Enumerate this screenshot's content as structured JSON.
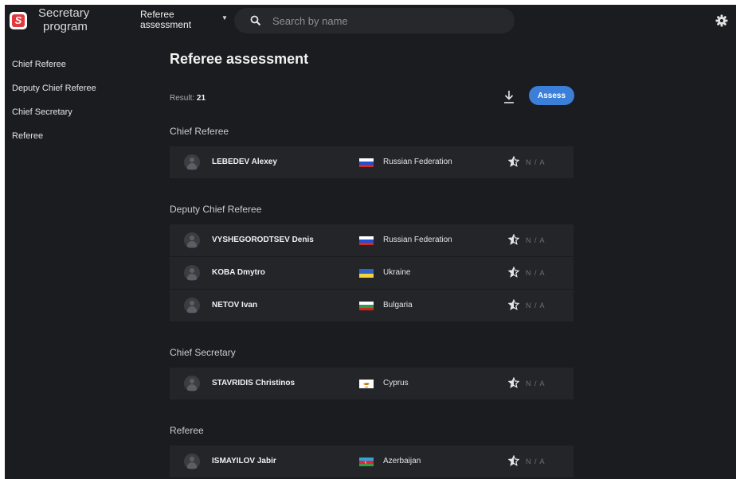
{
  "app": {
    "title_line1": "Secretary",
    "title_line2": "program",
    "logo_letter": "S",
    "accent": "#3b7fd9",
    "logo_color": "#e0393e"
  },
  "header": {
    "module_line1": "Referee",
    "module_line2": "assessment",
    "search_placeholder": "Search by name"
  },
  "sidebar": {
    "items": [
      {
        "label": "Chief Referee"
      },
      {
        "label": "Deputy Chief Referee"
      },
      {
        "label": "Chief Secretary"
      },
      {
        "label": "Referee"
      }
    ]
  },
  "main": {
    "title": "Referee assessment",
    "result_label": "Result:",
    "result_count": "21",
    "assess_label": "Assess",
    "groups": [
      {
        "title": "Chief Referee",
        "rows": [
          {
            "name": "LEBEDEV Alexey",
            "country": "Russian Federation",
            "flag": "russia",
            "rating": "N / A"
          }
        ]
      },
      {
        "title": "Deputy Chief Referee",
        "rows": [
          {
            "name": "VYSHEGORODTSEV Denis",
            "country": "Russian Federation",
            "flag": "russia",
            "rating": "N / A"
          },
          {
            "name": "KOBA Dmytro",
            "country": "Ukraine",
            "flag": "ukraine",
            "rating": "N / A"
          },
          {
            "name": "NETOV Ivan",
            "country": "Bulgaria",
            "flag": "bulgaria",
            "rating": "N / A"
          }
        ]
      },
      {
        "title": "Chief Secretary",
        "rows": [
          {
            "name": "STAVRIDIS Christinos",
            "country": "Cyprus",
            "flag": "cyprus",
            "rating": "N / A"
          }
        ]
      },
      {
        "title": "Referee",
        "rows": [
          {
            "name": "ISMAYILOV Jabir",
            "country": "Azerbaijan",
            "flag": "azerbaijan",
            "rating": "N / A"
          }
        ]
      }
    ]
  }
}
